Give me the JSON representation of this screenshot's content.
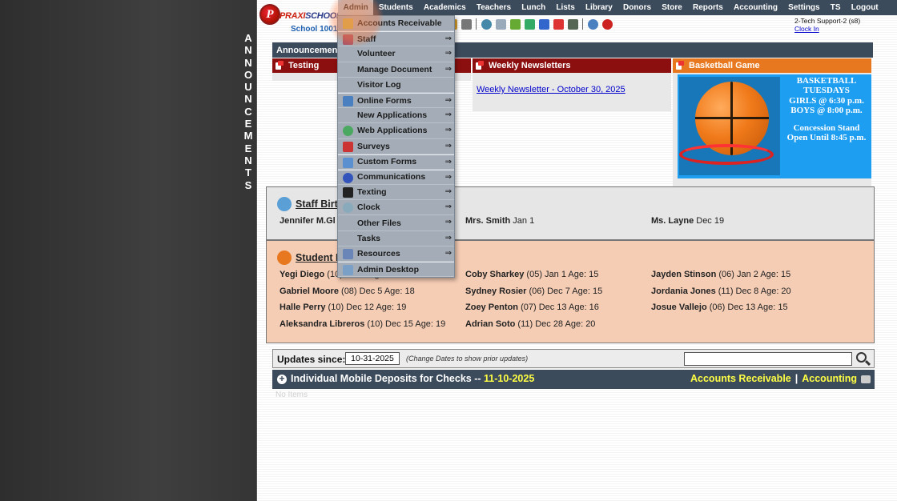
{
  "side_label": [
    "A",
    "N",
    "N",
    "O",
    "U",
    "N",
    "C",
    "E",
    "M",
    "E",
    "N",
    "T",
    "S"
  ],
  "logo": {
    "brand_main": "PRAXI",
    "brand_rest": "SCHOOL",
    "letter": "P",
    "school": "School 1001"
  },
  "nav": {
    "items": [
      "Admin",
      "Students",
      "Academics",
      "Teachers",
      "Lunch",
      "Lists",
      "Library",
      "Donors",
      "Store",
      "Reports",
      "Accounting",
      "Settings",
      "TS",
      "Logout"
    ],
    "active": "Admin"
  },
  "user": {
    "name": "2-Tech Support-2 (s8)",
    "clock_link": "Clock In"
  },
  "toolbar_icons": [
    "report-icon",
    "person-icon",
    "person-icon",
    "group-icon",
    "money-icon",
    "book-icon",
    "cheese-icon",
    "certificate-icon",
    "person-icon",
    "clock-icon",
    "calendar-icon",
    "card-icon",
    "printer-icon",
    "ap-icon",
    "pdf-icon",
    "mail-icon",
    "help-icon",
    "power-icon"
  ],
  "announcements": {
    "bar_title": "Announcements",
    "panels": [
      {
        "title": "Testing"
      },
      {
        "title": "Weekly Newsletters",
        "link": "Weekly Newsletter - October 30, 2025"
      },
      {
        "title": "Basketball Game"
      }
    ],
    "basketball_text": [
      "BASKETBALL",
      "TUESDAYS",
      "GIRLS @ 6:30 p.m.",
      "BOYS  @ 8:00 p.m.",
      "",
      "Concession Stand",
      "Open Until 8:45 p.m."
    ]
  },
  "admin_menu": [
    {
      "label": "Accounts Receivable",
      "icon": "money-icon",
      "submenu": false
    },
    {
      "label": "Staff",
      "icon": "staff-icon",
      "submenu": true
    },
    {
      "label": "Volunteer",
      "icon": "",
      "submenu": true
    },
    {
      "label": "Manage Document",
      "icon": "",
      "submenu": true
    },
    {
      "label": "Visitor Log",
      "icon": "",
      "submenu": false
    },
    {
      "label": "Online Forms",
      "icon": "forms-icon",
      "submenu": true
    },
    {
      "label": "New Applications",
      "icon": "",
      "submenu": true
    },
    {
      "label": "Web Applications",
      "icon": "globe-icon",
      "submenu": true
    },
    {
      "label": "Surveys",
      "icon": "survey-icon",
      "submenu": true
    },
    {
      "label": "Custom Forms",
      "icon": "custom-forms-icon",
      "submenu": true
    },
    {
      "label": "Communications",
      "icon": "at-icon",
      "submenu": true
    },
    {
      "label": "Texting",
      "icon": "phone-icon",
      "submenu": true
    },
    {
      "label": "Clock",
      "icon": "clock-icon",
      "submenu": true
    },
    {
      "label": "Other Files",
      "icon": "",
      "submenu": true
    },
    {
      "label": "Tasks",
      "icon": "",
      "submenu": true
    },
    {
      "label": "Resources",
      "icon": "resources-icon",
      "submenu": true
    },
    {
      "label": "Admin Desktop",
      "icon": "desktop-icon",
      "submenu": false
    }
  ],
  "arrow_glyph": "⇒",
  "staff_birthdays": {
    "title": "Staff Birthdays",
    "entries": [
      {
        "name": "Jennifer M.Gl",
        "info": ""
      },
      {
        "name": "Mrs. Smith",
        "info": " Jan 1"
      },
      {
        "name": "Ms. Layne",
        "info": " Dec 19"
      }
    ]
  },
  "student_birthdays": {
    "title": "Student Birthdays",
    "entries": [
      {
        "name": "Yegi Diego",
        "info": " (10) Jan 1 Age: 15"
      },
      {
        "name": "Coby Sharkey",
        "info": " (05) Jan 1 Age: 15"
      },
      {
        "name": "Jayden Stinson",
        "info": " (06) Jan 2 Age: 15"
      },
      {
        "name": "Gabriel Moore",
        "info": " (08) Dec 5 Age: 18"
      },
      {
        "name": "Sydney Rosier",
        "info": " (06) Dec 7 Age: 15"
      },
      {
        "name": "Jordania Jones",
        "info": " (11) Dec 8 Age: 20"
      },
      {
        "name": "Halle Perry",
        "info": " (10) Dec 12 Age: 19"
      },
      {
        "name": "Zoey Penton",
        "info": " (07) Dec 13 Age: 16"
      },
      {
        "name": "Josue Vallejo",
        "info": " (06) Dec 13 Age: 15"
      },
      {
        "name": "Aleksandra Libreros",
        "info": " (10) Dec 15 Age: 19"
      },
      {
        "name": "Adrian Soto",
        "info": " (11) Dec 28 Age: 20"
      }
    ]
  },
  "updates": {
    "label": "Updates since:",
    "date": "10-31-2025",
    "hint": "(Change Dates to show prior updates)",
    "search_value": ""
  },
  "deposits": {
    "title": "Individual Mobile Deposits for Checks -- ",
    "date": "11-10-2025",
    "link1": "Accounts Receivable",
    "separator": "|",
    "link2": "Accounting",
    "faded_note": "No Items"
  },
  "colors": {
    "nav_bg": "#3c4b5c",
    "ann_red": "#8b0f0f",
    "ann_orange": "#e8781f",
    "highlight_yellow": "#ffff44",
    "student_bg": "#f5cdb5"
  }
}
